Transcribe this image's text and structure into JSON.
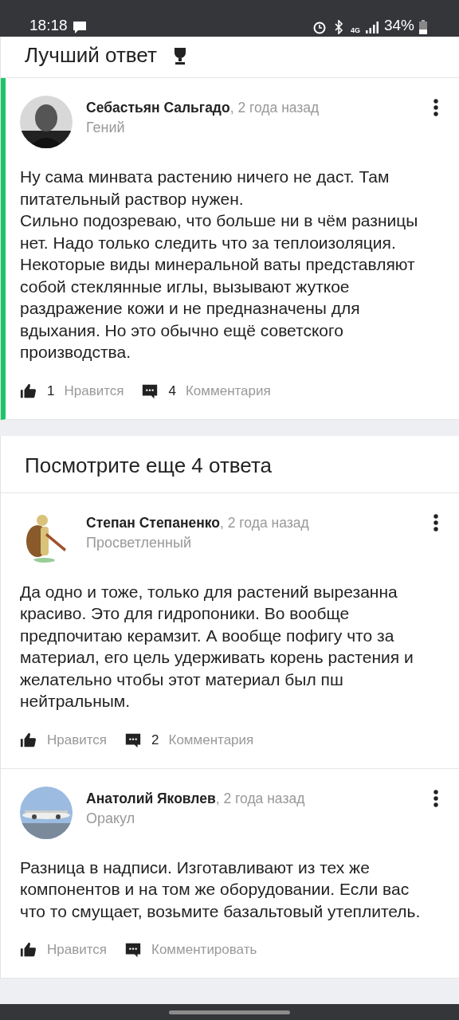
{
  "status_bar": {
    "time": "18:18",
    "network": "4G",
    "battery": "34%"
  },
  "best_answer": {
    "title": "Лучший ответ",
    "answer": {
      "author": "Себастьян Сальгадо",
      "time": ", 2 года назад",
      "rank": "Гений",
      "text": "Ну сама минвата растению ничего не даст. Там питательный раствор нужен.\nСильно подозреваю, что больше ни в чём разницы нет. Надо только следить что за теплоизоляция. Некоторые виды минеральной ваты представляют собой стеклянные иглы, вызывают жуткое раздражение кожи и не предназначены для вдыхания. Но это обычно ещё советского производства.",
      "likes": "1",
      "like_label": "Нравится",
      "comments": "4",
      "comment_label": "Комментария"
    }
  },
  "more_answers": {
    "title": "Посмотрите еще 4 ответа",
    "answers": [
      {
        "author": "Степан Степаненко",
        "time": ", 2 года назад",
        "rank": "Просветленный",
        "text": "Да одно и тоже, только для растений вырезанна красиво. Это для гидропоники. Во вообще предпочитаю керамзит. А вообще пофигу что за материал, его цель удерживать корень растения и желательно чтобы этот материал был пш нейтральным.",
        "like_label": "Нравится",
        "comments": "2",
        "comment_label": "Комментария"
      },
      {
        "author": "Анатолий Яковлев",
        "time": ", 2 года назад",
        "rank": "Оракул",
        "text": "Разница в надписи. Изготавливают из тех же компонентов и на том же оборудовании. Если вас что то смущает, возьмите базальтовый утеплитель.",
        "like_label": "Нравится",
        "comment_label": "Комментировать"
      }
    ]
  }
}
